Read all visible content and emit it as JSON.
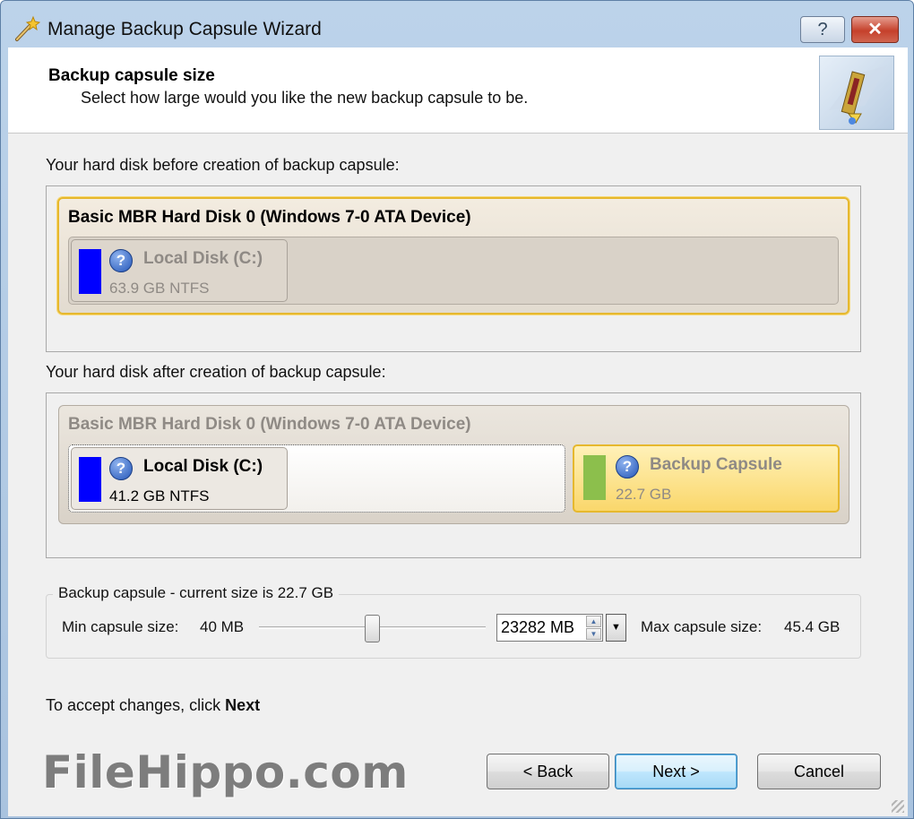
{
  "window": {
    "title": "Manage Backup Capsule Wizard",
    "help_label": "?",
    "close_label": "✕"
  },
  "header": {
    "title": "Backup capsule size",
    "subtitle": "Select how large would you like the new backup capsule to be."
  },
  "before": {
    "label": "Your hard disk before creation of backup capsule:",
    "disk_name": "Basic MBR Hard Disk 0 (Windows 7-0 ATA Device)",
    "partitions": [
      {
        "name": "Local Disk (C:)",
        "size": "63.9 GB NTFS",
        "color": "#0000ff"
      }
    ]
  },
  "after": {
    "label": "Your hard disk after creation of backup capsule:",
    "disk_name": "Basic MBR Hard Disk 0 (Windows 7-0 ATA Device)",
    "partitions": [
      {
        "name": "Local Disk (C:)",
        "size": "41.2 GB NTFS",
        "color": "#0000ff"
      },
      {
        "name": "Backup Capsule",
        "size": "22.7 GB",
        "color": "#8cbf4c"
      }
    ]
  },
  "capsule": {
    "legend": "Backup capsule - current size is 22.7 GB",
    "min_label": "Min capsule size:",
    "min_value": "40 MB",
    "size_value": "23282 MB",
    "max_label": "Max capsule size:",
    "max_value": "45.4 GB",
    "slider_fraction": 0.5
  },
  "footer": {
    "accept_prefix": "To accept changes, click ",
    "accept_bold": "Next",
    "watermark": "FileHippo.com",
    "back_label": "< Back",
    "next_label": "Next >",
    "cancel_label": "Cancel"
  }
}
